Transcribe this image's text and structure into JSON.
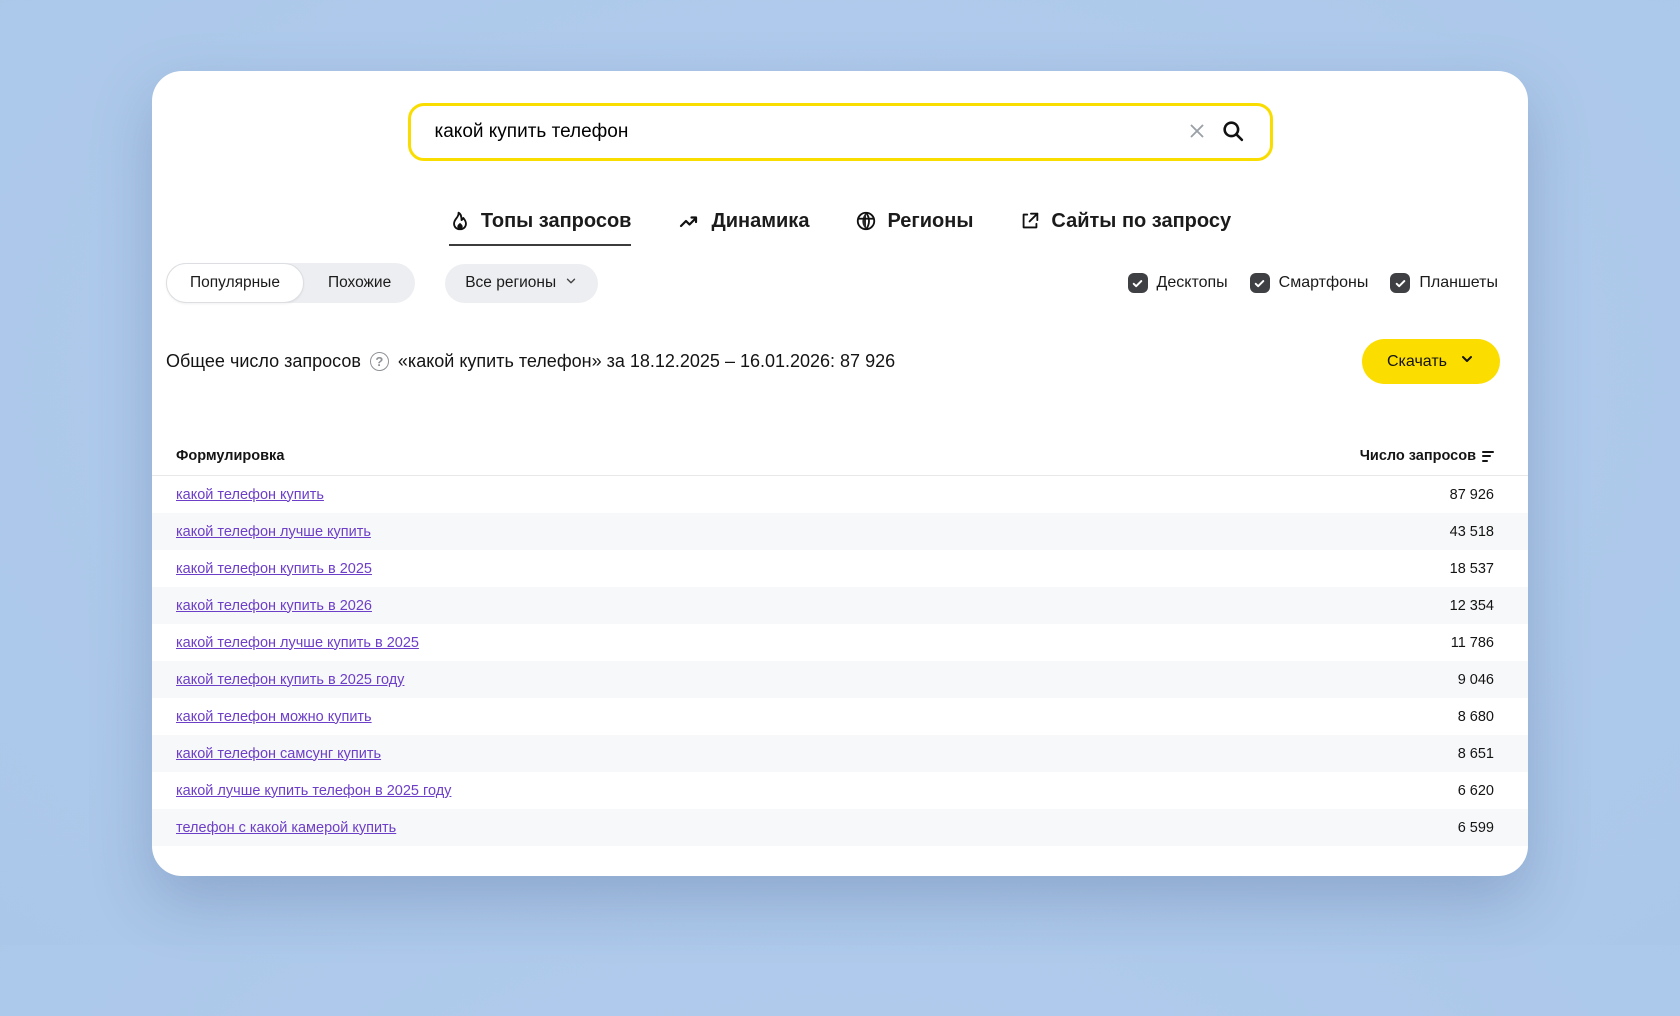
{
  "search": {
    "value": "какой купить телефон",
    "clear_icon": "close-icon",
    "submit_icon": "search-icon"
  },
  "tabs": [
    {
      "label": "Топы запросов",
      "icon": "fire-icon",
      "active": true
    },
    {
      "label": "Динамика",
      "icon": "trending-up-icon",
      "active": false
    },
    {
      "label": "Регионы",
      "icon": "globe-icon",
      "active": false
    },
    {
      "label": "Сайты по запросу",
      "icon": "external-link-icon",
      "active": false
    }
  ],
  "filters": {
    "mode_toggle": {
      "options": [
        {
          "label": "Популярные",
          "selected": true
        },
        {
          "label": "Похожие",
          "selected": false
        }
      ]
    },
    "region_selector": {
      "label": "Все регионы",
      "icon": "chevron-down-icon"
    },
    "devices": [
      {
        "label": "Десктопы",
        "checked": true
      },
      {
        "label": "Смартфоны",
        "checked": true
      },
      {
        "label": "Планшеты",
        "checked": true
      }
    ]
  },
  "summary": {
    "text_before_icon": "Общее число запросов",
    "help_icon": "?",
    "text_after_icon": "«какой купить телефон» за 18.12.2025 – 16.01.2026: 87 926"
  },
  "download": {
    "label": "Скачать",
    "icon": "chevron-down-icon"
  },
  "table": {
    "columns": {
      "phrase": "Формулировка",
      "count": "Число запросов"
    },
    "rows": [
      {
        "query": "какой телефон купить",
        "count": "87 926"
      },
      {
        "query": "какой телефон лучше купить",
        "count": "43 518"
      },
      {
        "query": "какой телефон купить в 2025",
        "count": "18 537"
      },
      {
        "query": "какой телефон купить в 2026",
        "count": "12 354"
      },
      {
        "query": "какой телефон лучше купить в 2025",
        "count": "11 786"
      },
      {
        "query": "какой телефон купить в 2025 году",
        "count": "9 046"
      },
      {
        "query": "какой телефон можно купить",
        "count": "8 680"
      },
      {
        "query": "какой телефон самсунг купить",
        "count": "8 651"
      },
      {
        "query": "какой лучше купить телефон в 2025 году",
        "count": "6 620"
      },
      {
        "query": "телефон с какой камерой купить",
        "count": "6 599"
      }
    ]
  },
  "colors": {
    "accent_yellow": "#fbdd00",
    "link_purple": "#6d3fc8",
    "background_blue": "#abc7e9",
    "checkbox_dark": "#3f4043"
  }
}
